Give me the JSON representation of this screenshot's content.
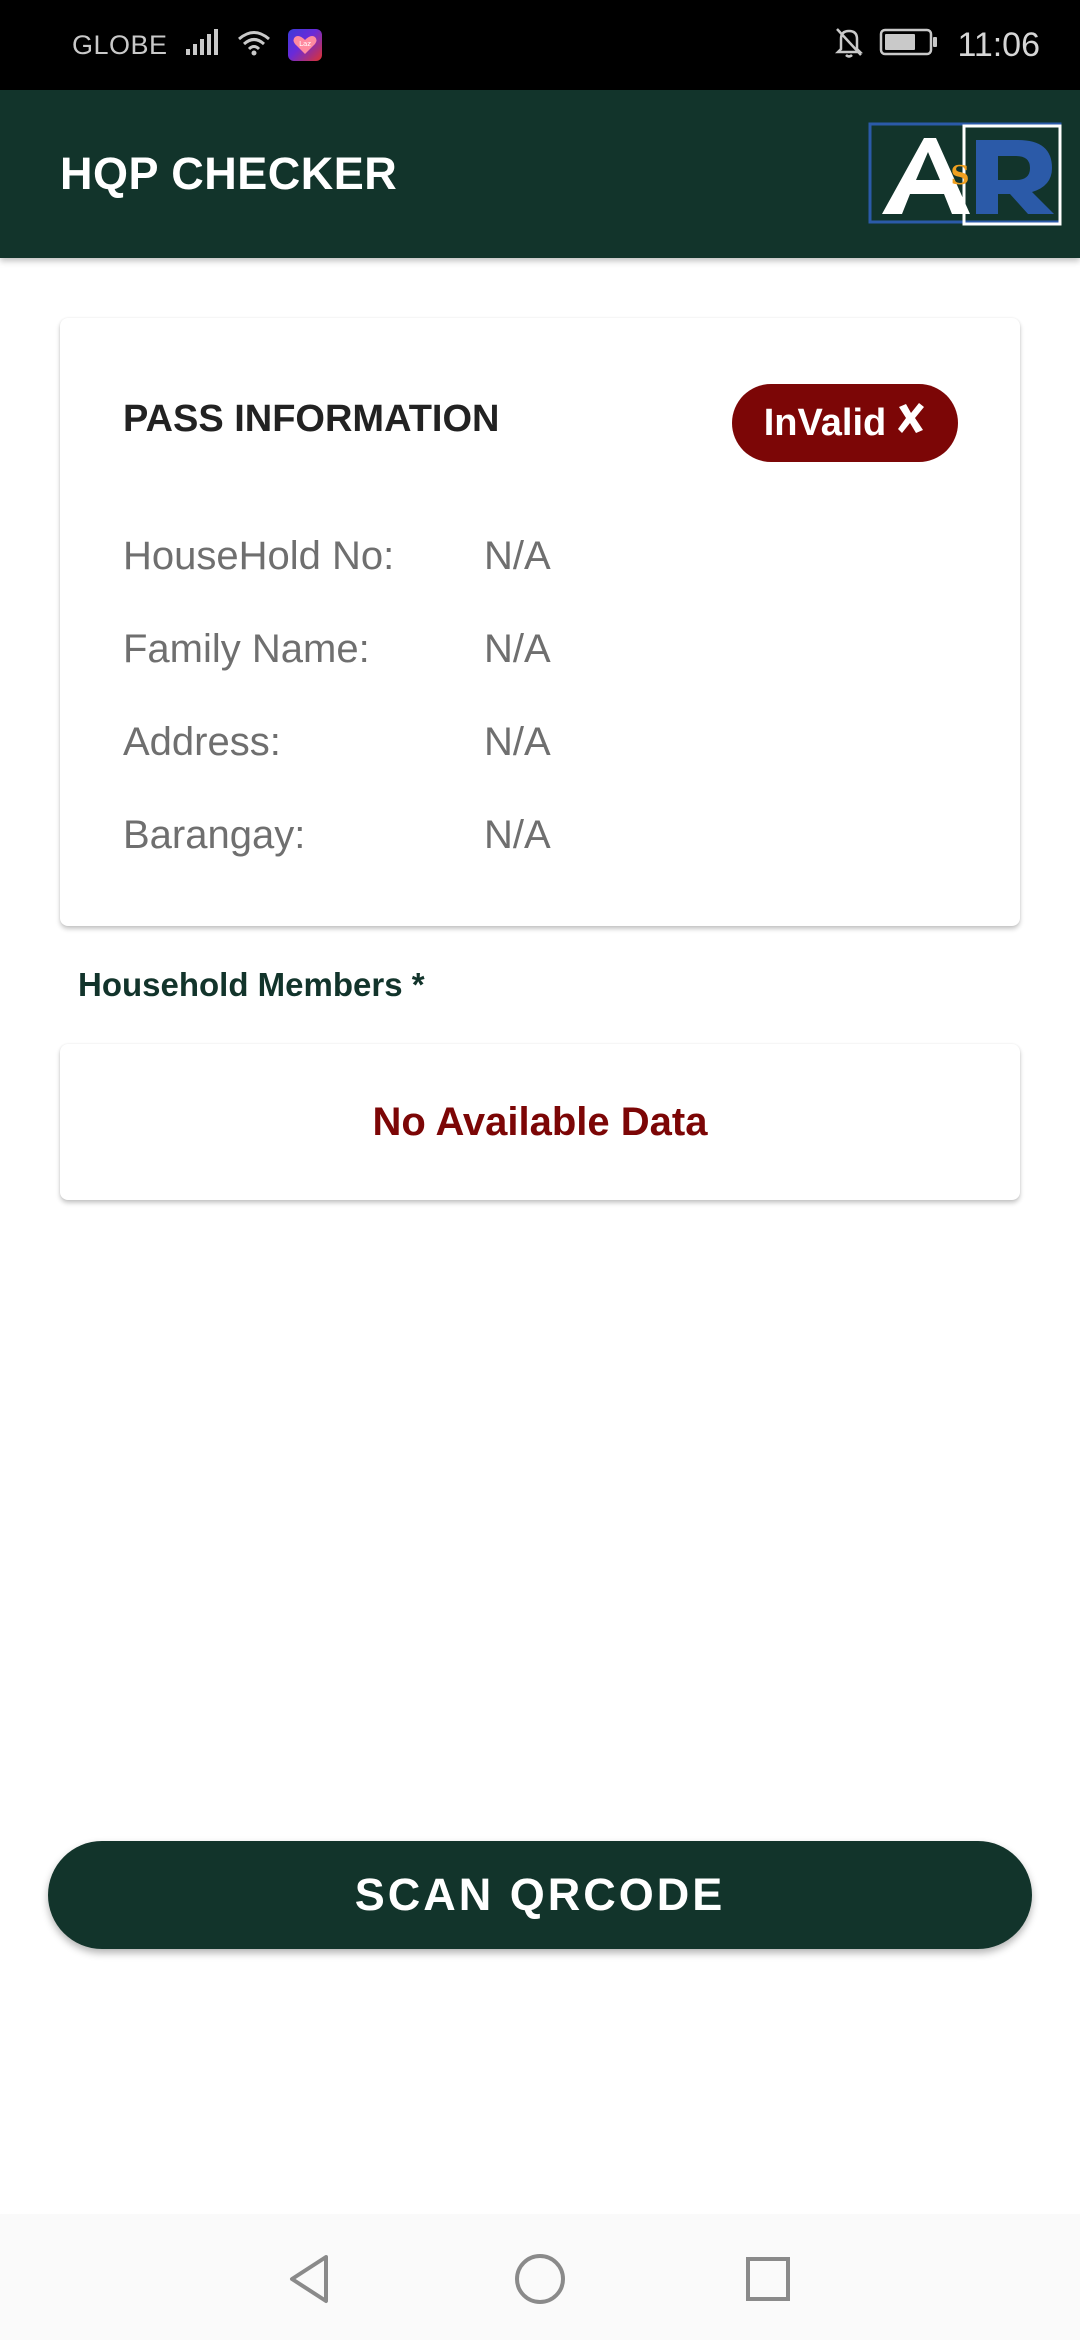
{
  "status_bar": {
    "carrier": "GLOBE",
    "app_badge_text": "Laz",
    "time": "11:06"
  },
  "app_bar": {
    "title": "HQP CHECKER",
    "logo": {
      "letters": "A&R",
      "icon": "asr-logo"
    }
  },
  "pass_info": {
    "title": "PASS INFORMATION",
    "status": {
      "label": "InValid",
      "icon": "x-mark-icon",
      "color": "#7c0606"
    },
    "fields": [
      {
        "label": "HouseHold No:",
        "value": "N/A"
      },
      {
        "label": "Family Name:",
        "value": "N/A"
      },
      {
        "label": "Address:",
        "value": "N/A"
      },
      {
        "label": "Barangay:",
        "value": "N/A"
      }
    ]
  },
  "household_members": {
    "label": "Household Members *",
    "empty_text": "No Available Data"
  },
  "actions": {
    "scan_label": "SCAN QRCODE"
  },
  "colors": {
    "primary": "#12342b",
    "danger": "#7c0606",
    "text_muted": "#6f6f6f"
  },
  "nav_bar": {
    "icons": [
      "back-triangle-icon",
      "home-circle-icon",
      "recents-square-icon"
    ]
  }
}
